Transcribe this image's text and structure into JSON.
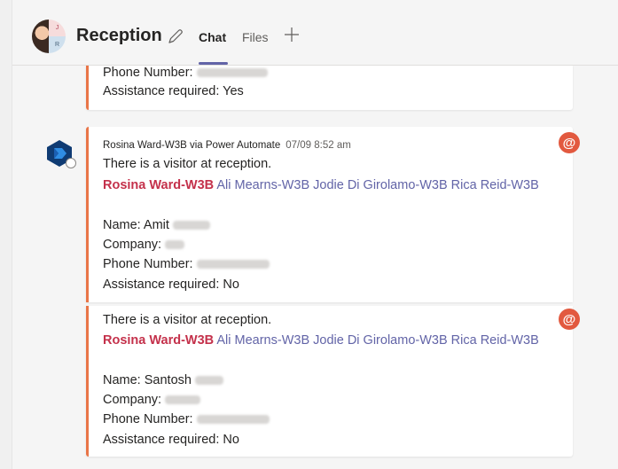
{
  "header": {
    "avatar_initials": [
      "J",
      "R"
    ],
    "title": "Reception",
    "tabs": [
      "Chat",
      "Files"
    ]
  },
  "messages": [
    {
      "continued": true,
      "phone_label": "Phone Number:",
      "assistance": "Assistance required: Yes"
    },
    {
      "sender": "Rosina Ward-W3B via Power Automate",
      "timestamp": "07/09 8:52 am",
      "intro": "There is a visitor at reception.",
      "mention_me": "Rosina Ward-W3B",
      "mentions": "Ali Mearns-W3B Jodie Di Girolamo-W3B Rica Reid-W3B",
      "name_label": "Name:  Amit",
      "company_label": "Company:",
      "phone_label": "Phone Number:",
      "assistance": "Assistance required: No",
      "badge": "@"
    },
    {
      "intro": "There is a visitor at reception.",
      "mention_me": "Rosina Ward-W3B",
      "mentions": "Ali Mearns-W3B Jodie Di Girolamo-W3B Rica Reid-W3B",
      "name_label": "Name:  Santosh",
      "company_label": "Company:",
      "phone_label": "Phone Number:",
      "assistance": "Assistance required: No",
      "badge": "@"
    }
  ],
  "colors": {
    "accent": "#6264a7",
    "message_border": "#e97548",
    "mention_me": "#c4314b",
    "badge": "#e2593f"
  },
  "icons": {
    "edit": "pencil-icon",
    "add_tab": "plus-icon",
    "bot": "power-automate-icon"
  }
}
